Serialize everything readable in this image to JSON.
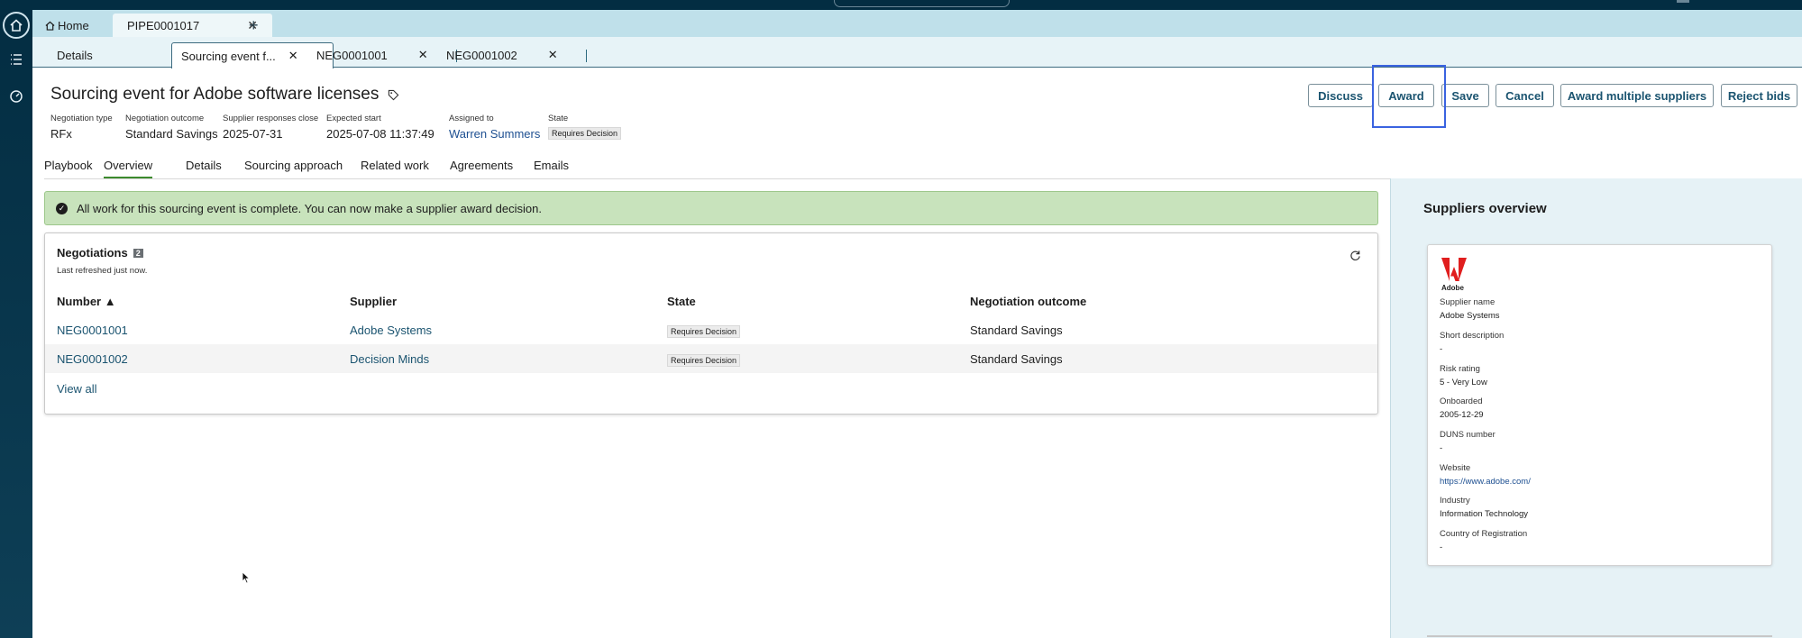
{
  "top_tabs": {
    "home_label": "Home",
    "active_tab": "PIPE0001017",
    "add_label": "+"
  },
  "sub_tabs": [
    {
      "label": "Details"
    },
    {
      "label": "Sourcing event f..."
    },
    {
      "label": "NEG0001001"
    },
    {
      "label": "NEG0001002"
    }
  ],
  "header": {
    "title": "Sourcing event for Adobe software licenses"
  },
  "actions": {
    "discuss": "Discuss",
    "award": "Award",
    "save": "Save",
    "cancel": "Cancel",
    "award_multiple": "Award multiple suppliers",
    "reject_bids": "Reject bids"
  },
  "meta": [
    {
      "label": "Negotiation type",
      "value": "RFx"
    },
    {
      "label": "Negotiation outcome",
      "value": "Standard Savings"
    },
    {
      "label": "Supplier responses close",
      "value": "2025-07-31"
    },
    {
      "label": "Expected start",
      "value": "2025-07-08 11:37:49"
    },
    {
      "label": "Assigned to",
      "value": "Warren Summers"
    },
    {
      "label": "State",
      "value": "Requires Decision"
    }
  ],
  "subnav": [
    "Playbook",
    "Overview",
    "Details",
    "Sourcing approach",
    "Related work",
    "Agreements",
    "Emails"
  ],
  "notice": "All work for this sourcing event is complete. You can now make a supplier award decision.",
  "negotiations": {
    "title": "Negotiations",
    "count": "2",
    "refreshed": "Last refreshed just now.",
    "columns": [
      "Number ▲",
      "Supplier",
      "State",
      "Negotiation outcome"
    ],
    "rows": [
      {
        "number": "NEG0001001",
        "supplier": "Adobe Systems",
        "state": "Requires Decision",
        "outcome": "Standard Savings"
      },
      {
        "number": "NEG0001002",
        "supplier": "Decision Minds",
        "state": "Requires Decision",
        "outcome": "Standard Savings"
      }
    ],
    "view_all": "View all"
  },
  "suppliers_overview": {
    "title": "Suppliers overview",
    "logo_text": "Adobe",
    "fields": [
      {
        "label": "Supplier name",
        "value": "Adobe Systems"
      },
      {
        "label": "Short description",
        "value": "-"
      },
      {
        "label": "Risk rating",
        "value": "5 - Very Low"
      },
      {
        "label": "Onboarded",
        "value": "2005-12-29"
      },
      {
        "label": "DUNS number",
        "value": "-"
      },
      {
        "label": "Website",
        "value": "https://www.adobe.com/"
      },
      {
        "label": "Industry",
        "value": "Information Technology"
      },
      {
        "label": "Country of Registration",
        "value": "-"
      }
    ]
  },
  "colors": {
    "accent": "#1b5470",
    "highlight_box": "#3a63e0",
    "notice_bg": "#c8e3bc",
    "rail": "#032d42"
  }
}
